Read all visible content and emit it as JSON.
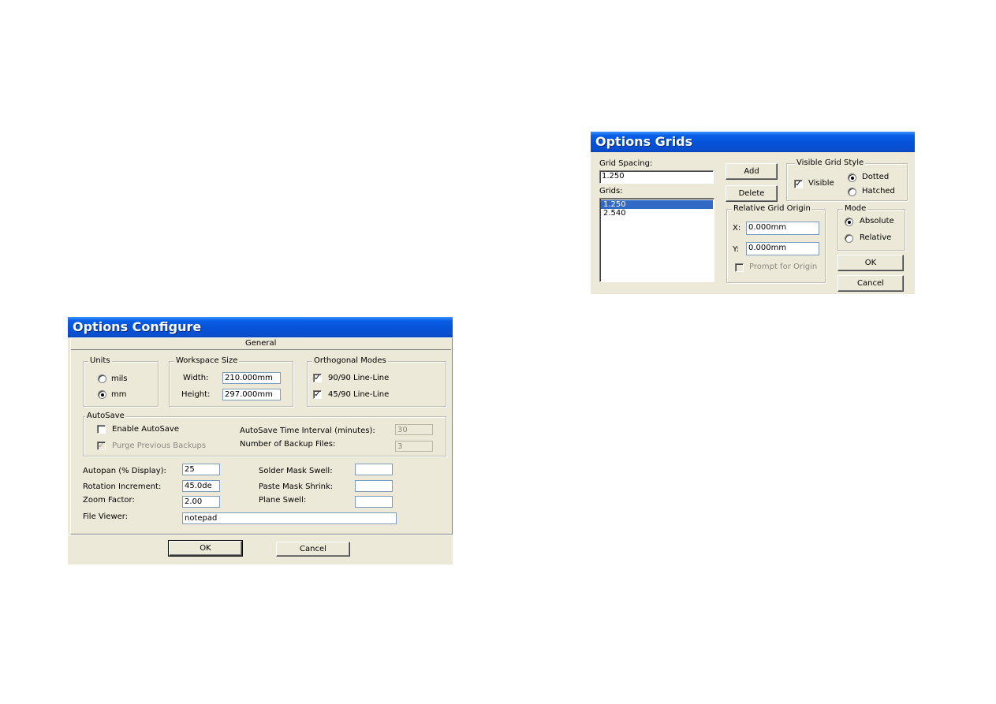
{
  "configure": {
    "title": "Options Configure",
    "tab_label": "General",
    "units": {
      "legend": "Units",
      "options": [
        "mils",
        "mm"
      ],
      "selected": "mm"
    },
    "workspace": {
      "legend": "Workspace Size",
      "width_label": "Width:",
      "width_value": "210.000mm",
      "height_label": "Height:",
      "height_value": "297.000mm"
    },
    "orthogonal": {
      "legend": "Orthogonal Modes",
      "mode1": "90/90  Line-Line",
      "mode2": "45/90  Line-Line",
      "mode1_checked": true,
      "mode2_checked": true
    },
    "autosave": {
      "legend": "AutoSave",
      "enable_label": "Enable AutoSave",
      "purge_label": "Purge Previous Backups",
      "interval_label": "AutoSave Time Interval (minutes):",
      "interval_value": "30",
      "backups_label": "Number of Backup Files:",
      "backups_value": "3"
    },
    "autopan_label": "Autopan (% Display):",
    "autopan_value": "25",
    "rotation_label": "Rotation Increment:",
    "rotation_value": "45.0de",
    "zoom_label": "Zoom Factor:",
    "zoom_value": "2.00",
    "solder_label": "Solder Mask Swell:",
    "solder_value": "",
    "paste_label": "Paste Mask Shrink:",
    "paste_value": "",
    "plane_label": "Plane Swell:",
    "plane_value": "",
    "viewer_label": "File Viewer:",
    "viewer_value": "notepad",
    "ok_label": "OK",
    "cancel_label": "Cancel"
  },
  "grids": {
    "title": "Options Grids",
    "spacing_label": "Grid Spacing:",
    "spacing_value": "1.250",
    "grids_label": "Grids:",
    "grid_items": [
      "1.250",
      "2.540"
    ],
    "selected_index": 0,
    "add_label": "Add",
    "delete_label": "Delete",
    "style": {
      "legend": "Visible Grid Style",
      "visible_label": "Visible",
      "visible_checked": true,
      "dotted_label": "Dotted",
      "hatched_label": "Hatched",
      "selected": "Dotted"
    },
    "origin": {
      "legend": "Relative Grid Origin",
      "x_label": "X:",
      "x_value": "0.000mm",
      "y_label": "Y:",
      "y_value": "0.000mm",
      "prompt_label": "Prompt for Origin"
    },
    "mode": {
      "legend": "Mode",
      "absolute_label": "Absolute",
      "relative_label": "Relative",
      "selected": "Absolute"
    },
    "ok_label": "OK",
    "cancel_label": "Cancel"
  }
}
